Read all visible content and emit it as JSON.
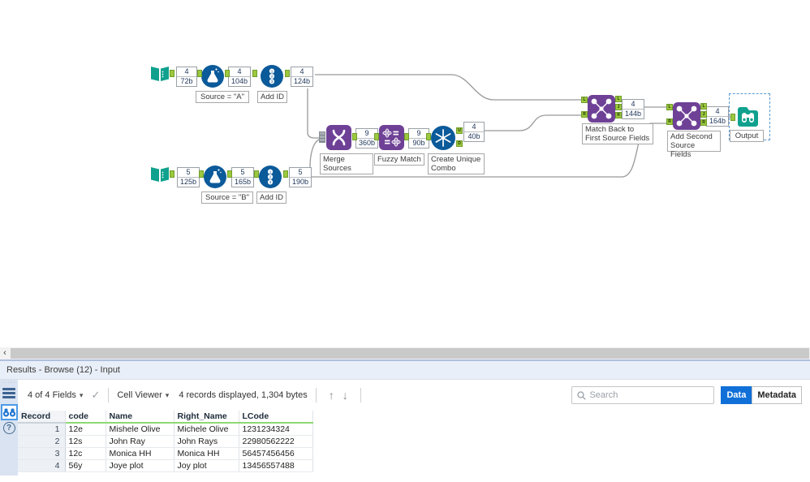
{
  "icons": {
    "caret_down": "▾",
    "check": "✓",
    "arrow_up": "↑",
    "arrow_down": "↓",
    "chevron_left": "‹",
    "question": "?",
    "drag_dots": "·····",
    "recordid_digits": [
      "1",
      "2",
      "3"
    ]
  },
  "colors": {
    "tool_blue": "#0b5a9a",
    "tool_purple": "#6e4196",
    "tool_teal": "#10a18e",
    "anchor_green": "#9dc83e",
    "selected_tab_blue": "#1070d8",
    "field_underline_green": "#8ed973",
    "wire_gray": "#999999"
  },
  "workflow": {
    "anchors": {
      "L": "L",
      "J": "J",
      "R": "R",
      "U": "U",
      "D": "D"
    },
    "annotations": {
      "input_a": {
        "count": "4",
        "bytes": "72b"
      },
      "formula_a": {
        "count": "4",
        "bytes": "104b"
      },
      "recordid_a": {
        "count": "4",
        "bytes": "124b"
      },
      "input_b": {
        "count": "5",
        "bytes": "125b"
      },
      "formula_b": {
        "count": "5",
        "bytes": "165b"
      },
      "recordid_b": {
        "count": "5",
        "bytes": "190b"
      },
      "union": {
        "count": "9",
        "bytes": "360b"
      },
      "fuzzy": {
        "count": "9",
        "bytes": "90b"
      },
      "unique": {
        "count": "4",
        "bytes": "40b"
      },
      "join1": {
        "count": "4",
        "bytes": "144b"
      },
      "join2": {
        "count": "4",
        "bytes": "164b"
      }
    },
    "labels": {
      "source_a": "Source = \"A\"",
      "add_id_a": "Add ID",
      "source_b": "Source = \"B\"",
      "add_id_b": "Add ID",
      "union": "Merge Sources",
      "fuzzy": "Fuzzy Match",
      "unique": "Create Unique Combo",
      "join1": "Match Back to First Source Fields",
      "join2": "Add Second Source Fields",
      "browse": "Output"
    }
  },
  "results": {
    "title": "Results - Browse (12) - Input",
    "toolbar": {
      "fields_selector": "4 of 4 Fields",
      "cell_viewer": "Cell Viewer",
      "records_info": "4 records displayed, 1,304 bytes",
      "search_placeholder": "Search",
      "data_tab": "Data",
      "metadata_tab": "Metadata"
    },
    "table": {
      "columns": [
        "Record",
        "code",
        "Name",
        "Right_Name",
        "LCode"
      ],
      "rows": [
        [
          "1",
          "12e",
          "Mishele Olive",
          "Michele Olive",
          "1231234324"
        ],
        [
          "2",
          "12s",
          "John Ray",
          "John Rays",
          "22980562222"
        ],
        [
          "3",
          "12c",
          "Monica HH",
          "Monica HH",
          "56457456456"
        ],
        [
          "4",
          "56y",
          "Joye plot",
          "Joy plot",
          "13456557488"
        ]
      ]
    }
  }
}
